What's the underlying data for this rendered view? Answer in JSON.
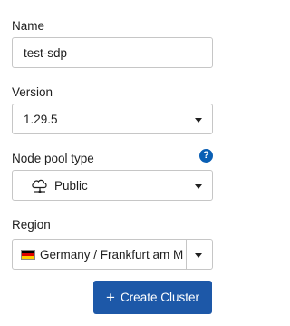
{
  "name": {
    "label": "Name",
    "value": "test-sdp"
  },
  "version": {
    "label": "Version",
    "value": "1.29.5"
  },
  "node_pool": {
    "label": "Node pool type",
    "value": "Public",
    "icon": "cloud-network-icon",
    "help_icon": "help-icon",
    "help_symbol": "?"
  },
  "region": {
    "label": "Region",
    "value": "Germany / Frankfurt am M",
    "flag_colors": [
      "#000000",
      "#dd0000",
      "#ffce00"
    ]
  },
  "create_button": {
    "label": "Create Cluster",
    "icon": "+",
    "color": "#1d58a8"
  }
}
